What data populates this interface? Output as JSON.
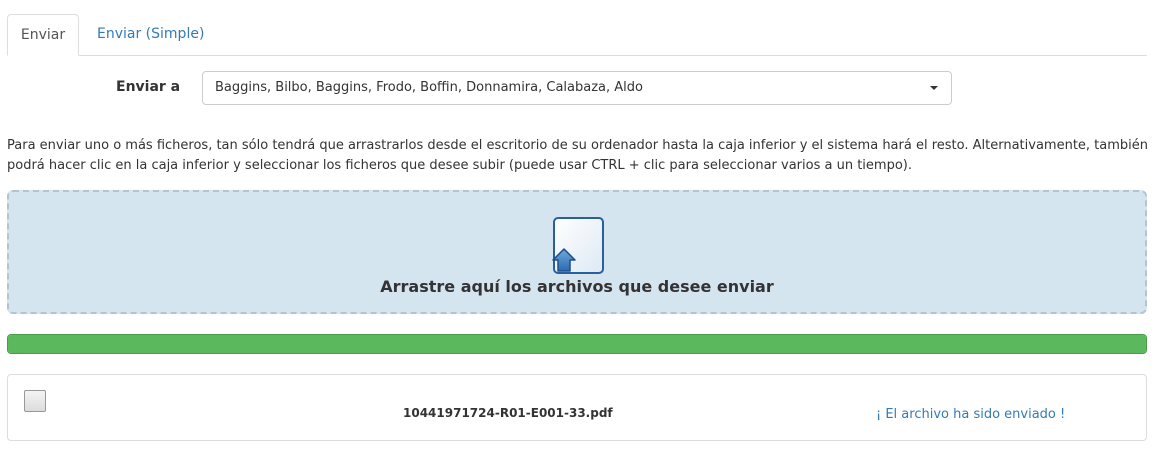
{
  "tabs": [
    {
      "label": "Enviar",
      "active": true
    },
    {
      "label": "Enviar (Simple)",
      "active": false
    }
  ],
  "send_to": {
    "label": "Enviar a",
    "selected": "Baggins, Bilbo, Baggins, Frodo, Boffin, Donnamira, Calabaza, Aldo"
  },
  "help_text": "Para enviar uno o más ficheros, tan sólo tendrá que arrastrarlos desde el escritorio de su ordenador hasta la caja inferior y el sistema hará el resto. Alternativamente, también podrá hacer clic en la caja inferior y seleccionar los ficheros que desee subir (puede usar CTRL + clic para seleccionar varios a un tiempo).",
  "dropzone": {
    "text": "Arrastre aquí los archivos que desee enviar",
    "icon": "file-upload-icon"
  },
  "upload": {
    "progress": 1.0
  },
  "files": [
    {
      "name": "10441971724-R01-E001-33.pdf",
      "status": "¡ El archivo ha sido enviado !",
      "checked": false
    }
  ],
  "colors": {
    "link": "#337ab7",
    "progress": "#5cb85c",
    "dropzone_bg": "#d4e5f0"
  }
}
